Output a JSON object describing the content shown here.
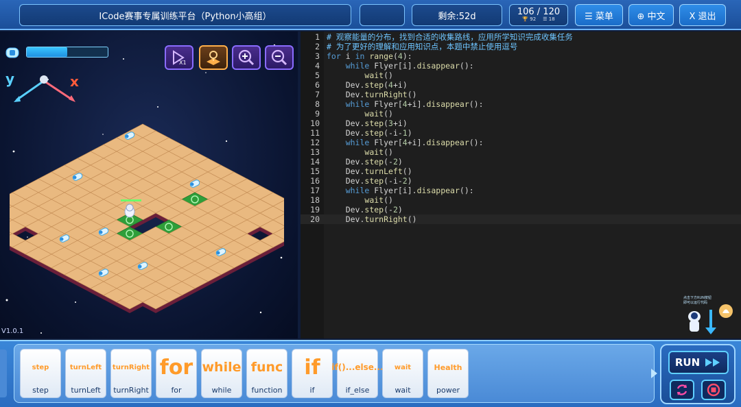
{
  "header": {
    "title": "ICode赛事专属训练平台（Python小高组）",
    "remaining": "剩余:52d",
    "score": "106 / 120",
    "score_sub_a": "92",
    "score_sub_b": "18",
    "menu_label": "☰ 菜单",
    "lang_label": "⊕ 中文",
    "exit_label": "X 退出"
  },
  "game": {
    "energy_level": 0.5,
    "axis_y": "y",
    "axis_x": "x",
    "version": "V1.0.1",
    "speed_label": "X1"
  },
  "code": {
    "lines": [
      "# 观察能量的分布，找到合适的收集路线，应用所学知识完成收集任务",
      "# 为了更好的理解和应用知识点，本题中禁止使用逗号",
      "for i in range(4):",
      "    while Flyer[i].disappear():",
      "        wait()",
      "    Dev.step(4+i)",
      "    Dev.turnRight()",
      "    while Flyer[4+i].disappear():",
      "        wait()",
      "    Dev.step(3+i)",
      "    Dev.step(-i-1)",
      "    while Flyer[4+i].disappear():",
      "        wait()",
      "    Dev.step(-2)",
      "    Dev.turnLeft()",
      "    Dev.step(-i-2)",
      "    while Flyer[i].disappear():",
      "        wait()",
      "    Dev.step(-2)",
      "    Dev.turnRight()"
    ],
    "line_numbers": [
      "1",
      "2",
      "3",
      "4",
      "5",
      "6",
      "7",
      "8",
      "9",
      "10",
      "11",
      "12",
      "13",
      "14",
      "15",
      "16",
      "17",
      "18",
      "19",
      "20"
    ]
  },
  "hint": {
    "text_1": "点击下方RUN按钮",
    "text_2": "即可以运行代码"
  },
  "blocks": [
    {
      "label": "step",
      "glyph": "step"
    },
    {
      "label": "turnLeft",
      "glyph": "turnLeft"
    },
    {
      "label": "turnRight",
      "glyph": "turnRight"
    },
    {
      "label": "for",
      "glyph": "for"
    },
    {
      "label": "while",
      "glyph": "while"
    },
    {
      "label": "function",
      "glyph": "func"
    },
    {
      "label": "if",
      "glyph": "if"
    },
    {
      "label": "if_else",
      "glyph": "if()...else..."
    },
    {
      "label": "wait",
      "glyph": "wait"
    },
    {
      "label": "power",
      "glyph": "Health"
    }
  ],
  "run": {
    "label": "RUN"
  },
  "colors": {
    "accent": "#2a66b8",
    "tile": "#e9b980",
    "block_orange": "#ff9b2a"
  }
}
